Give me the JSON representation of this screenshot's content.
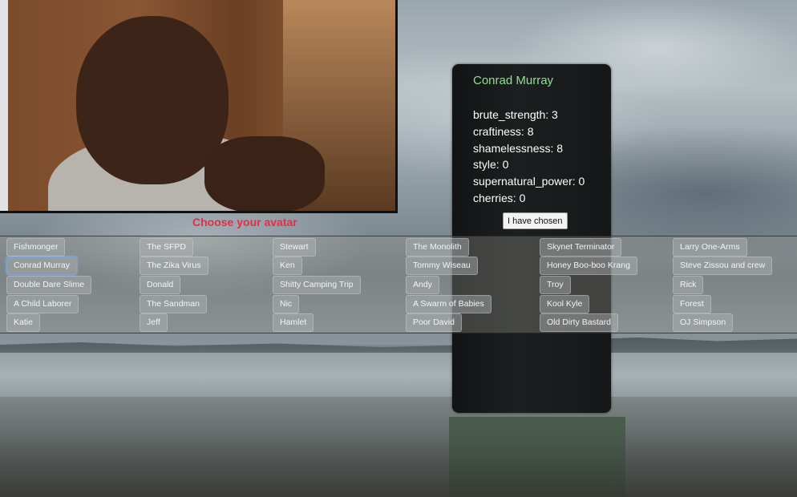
{
  "stats": {
    "name": "Conrad Murray",
    "lines": [
      "brute_strength: 3",
      "craftiness: 8",
      "shamelessness: 8",
      "style: 0",
      "supernatural_power: 0",
      "cherries: 0"
    ],
    "choose_button": "I have chosen"
  },
  "heading": "Choose your avatar",
  "selected": "Conrad Murray",
  "avatar_columns": [
    [
      "Fishmonger",
      "Conrad Murray",
      "Double Dare Slime",
      "A Child Laborer",
      "Katie"
    ],
    [
      "The SFPD",
      "The Zika Virus",
      "Donald",
      "The Sandman",
      "Jeff"
    ],
    [
      "Stewart",
      "Ken",
      "Shitty Camping Trip",
      "Nic",
      "Hamlet"
    ],
    [
      "The Monolith",
      "Tommy Wiseau",
      "Andy",
      "A Swarm of Babies",
      "Poor David"
    ],
    [
      "Skynet Terminator",
      "Honey Boo-boo Krang",
      "Troy",
      "Kool Kyle",
      "Old Dirty Bastard"
    ],
    [
      "Larry One-Arms",
      "Steve Zissou and crew",
      "Rick",
      "Forest",
      "OJ Simpson"
    ]
  ],
  "colors": {
    "name_green": "#8fe08f",
    "heading_red": "#e52d4a",
    "selected_outline": "#7fa6d6"
  }
}
